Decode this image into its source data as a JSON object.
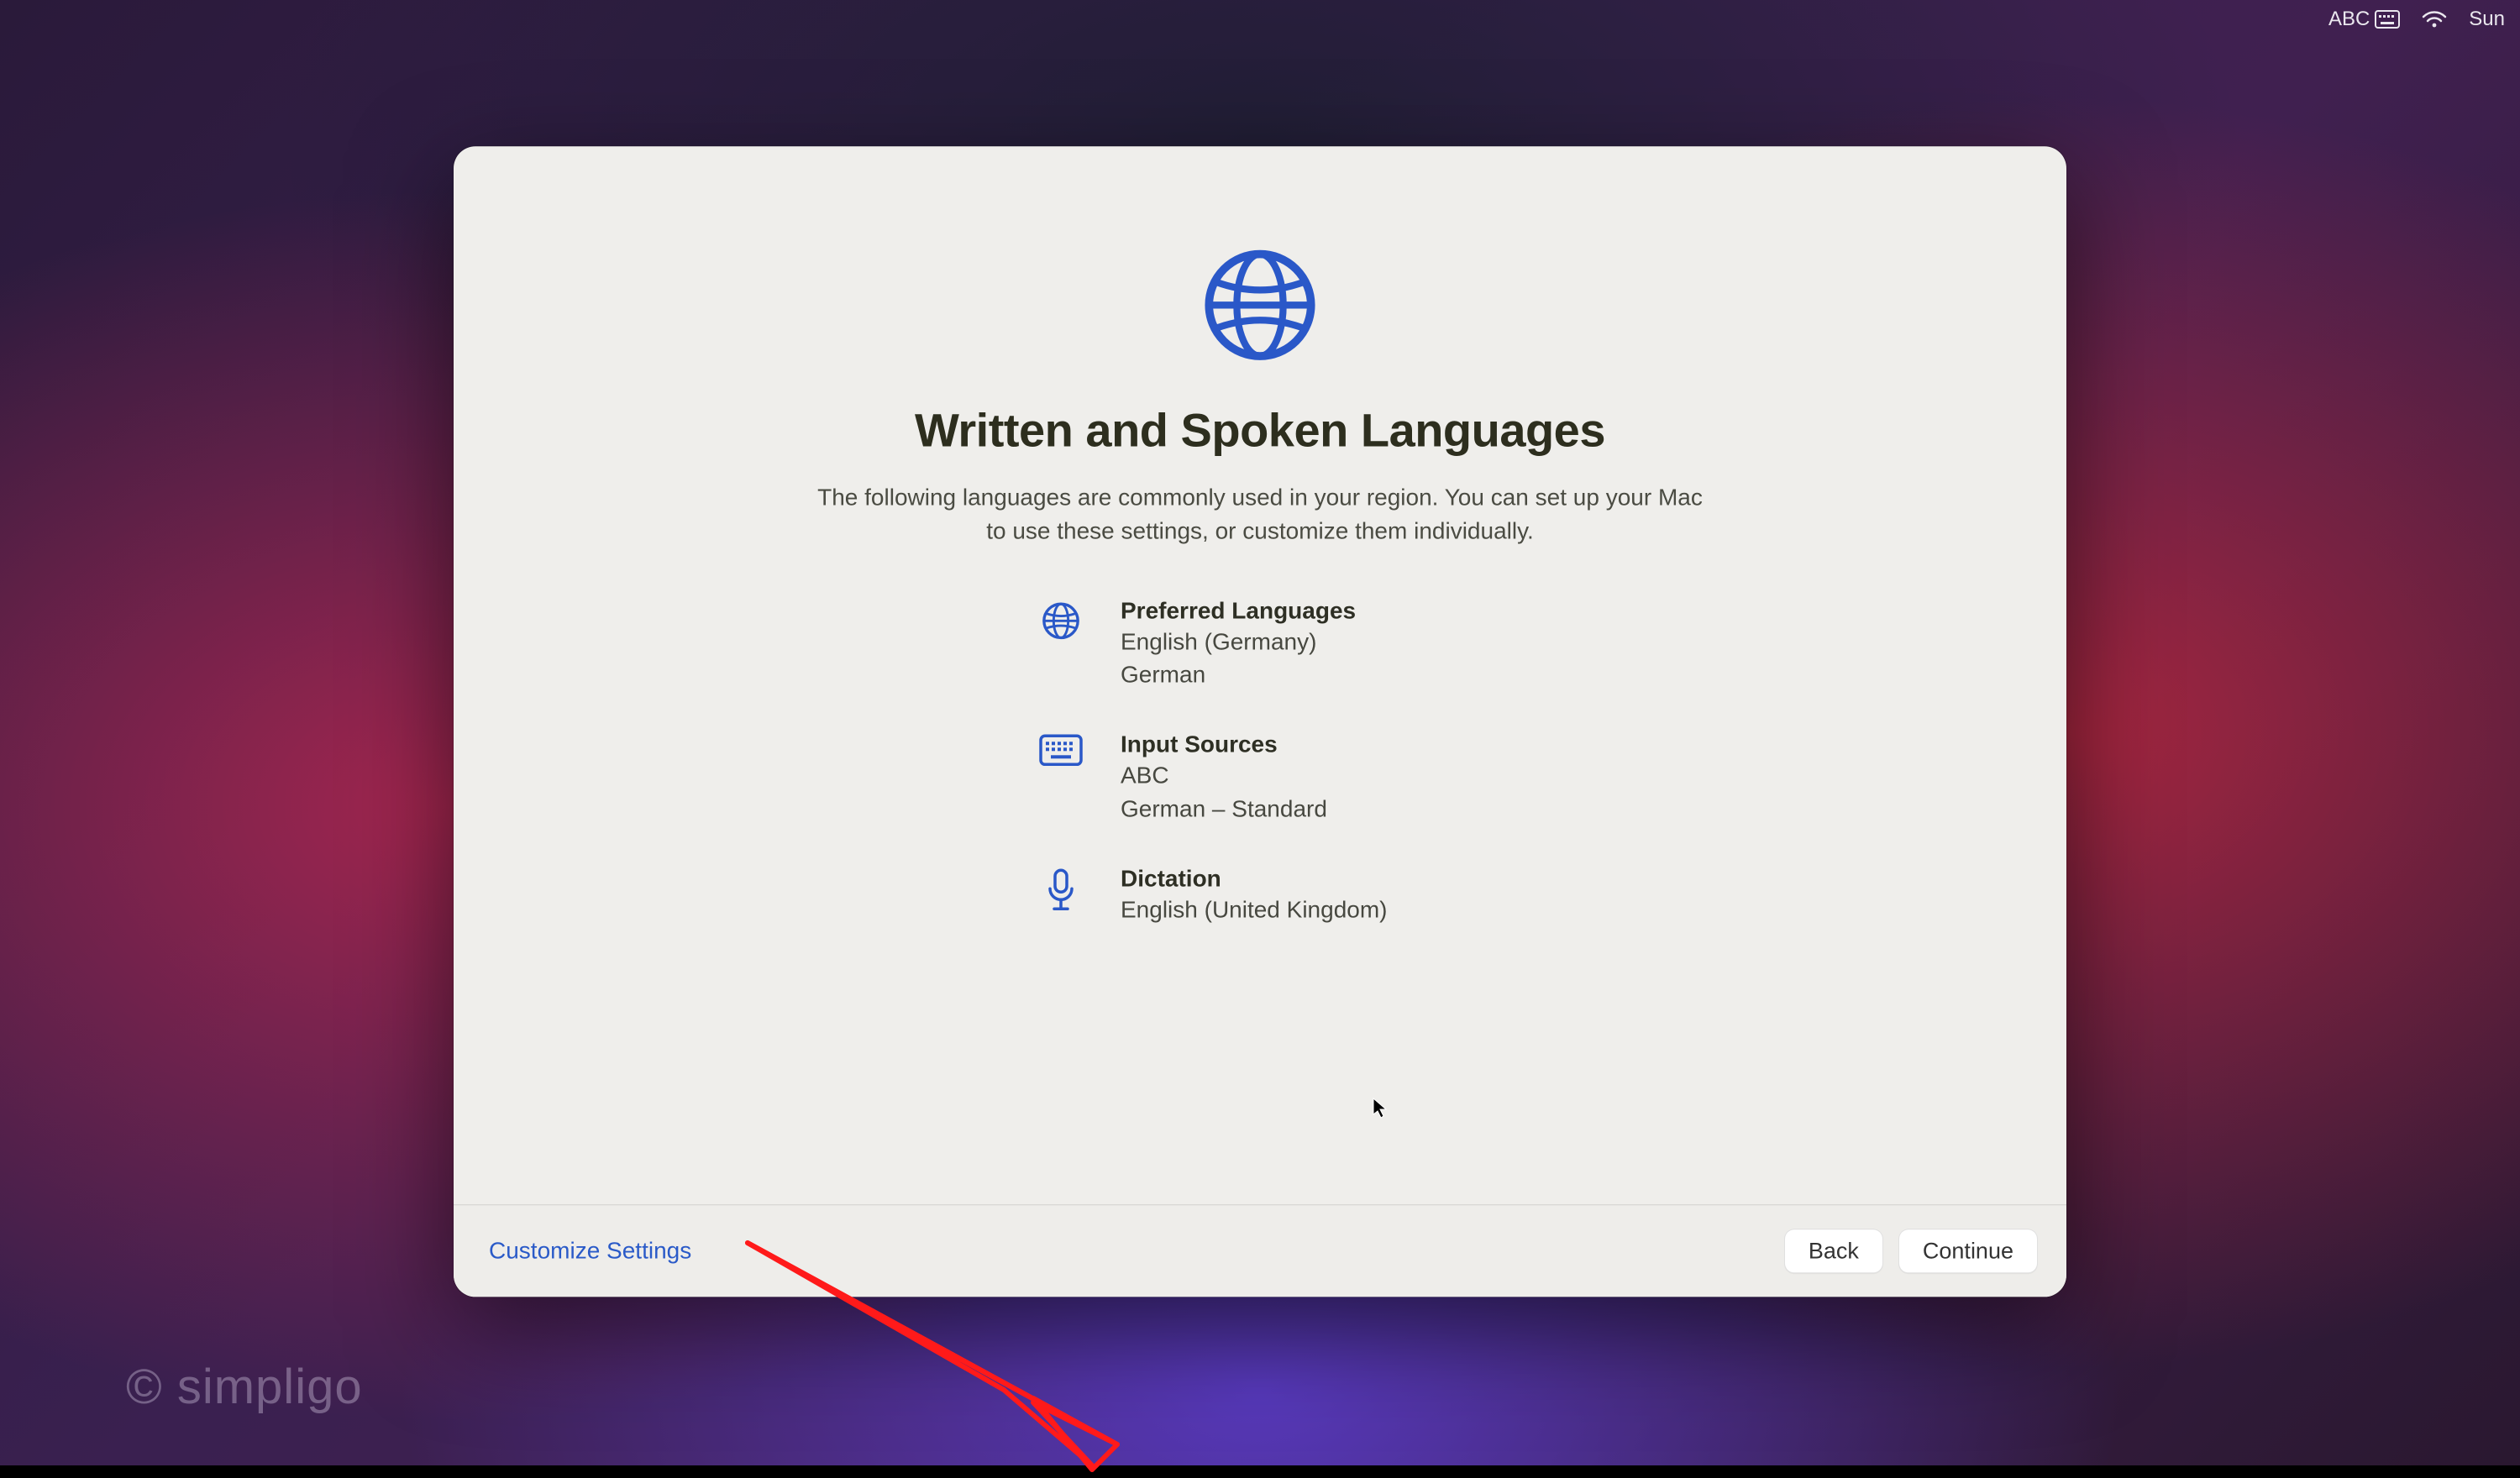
{
  "menubar": {
    "input_label": "ABC",
    "clock": "Sun "
  },
  "dialog": {
    "title": "Written and Spoken Languages",
    "subtitle": "The following languages are commonly used in your region. You can set up your Mac to use these settings, or customize them individually.",
    "sections": {
      "preferred": {
        "title": "Preferred Languages",
        "v1": "English (Germany)",
        "v2": "German"
      },
      "input": {
        "title": "Input Sources",
        "v1": "ABC",
        "v2": "German – Standard"
      },
      "dictation": {
        "title": "Dictation",
        "v1": "English (United Kingdom)"
      }
    },
    "footer": {
      "customize": "Customize Settings",
      "back": "Back",
      "continue": "Continue"
    }
  },
  "watermark": "© simpligo"
}
